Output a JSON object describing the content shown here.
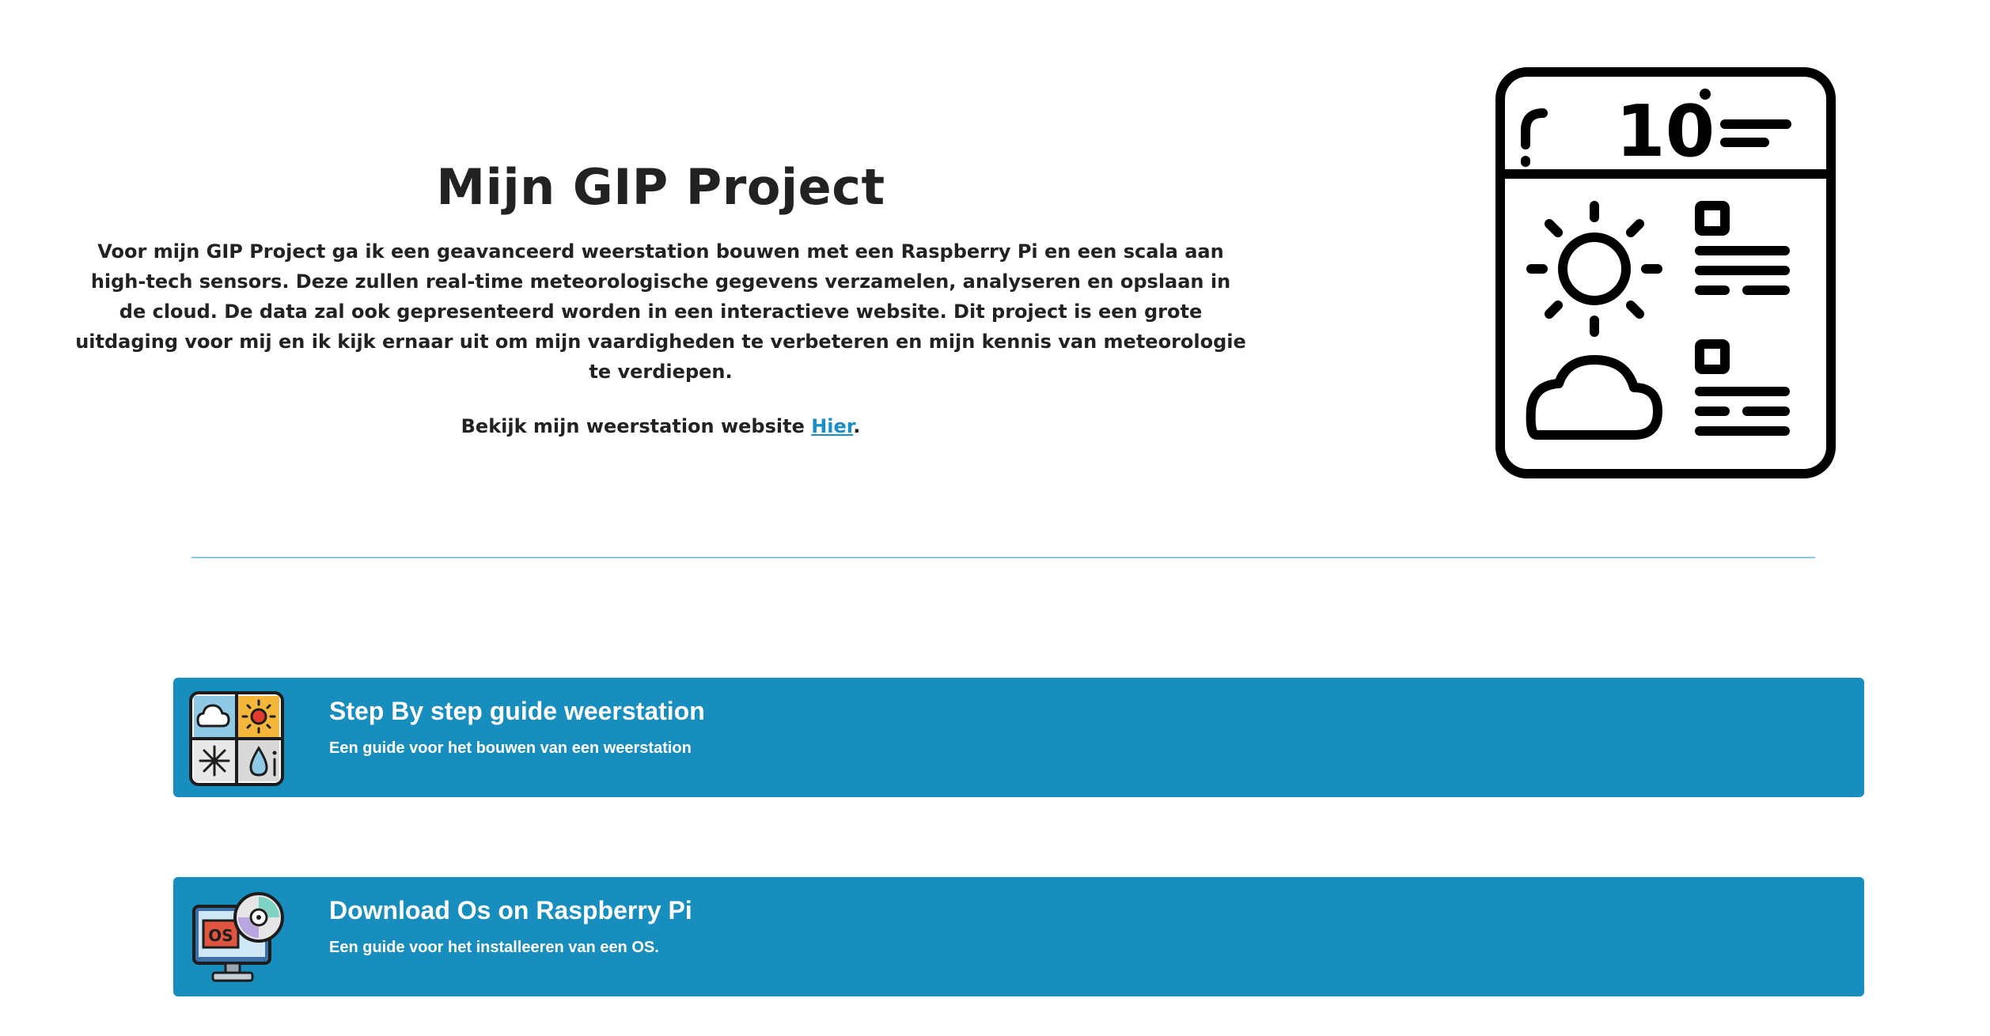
{
  "hero": {
    "title": "Mijn GIP Project",
    "description": "Voor mijn GIP Project ga ik een geavanceerd weerstation bouwen met een Raspberry Pi en een scala aan high-tech sensors. Deze zullen real-time meteorologische gegevens verzamelen, analyseren en opslaan in de cloud. De data zal ook gepresenteerd worden in een interactieve website. Dit project is een grote uitdaging voor mij en ik kijk ernaar uit om mijn vaardigheden te verbeteren en mijn kennis van meteorologie te verdiepen.",
    "link_prefix": "Bekijk mijn weerstation website ",
    "link_text": "Hier",
    "link_suffix": ".",
    "illustration": {
      "icon": "weather-app-icon",
      "temperature": "10"
    }
  },
  "cards": [
    {
      "title": "Step By step guide weerstation",
      "subtitle": "Een guide voor het bouwen van een weerstation",
      "icon": "weather-grid-icon"
    },
    {
      "title": "Download Os on Raspberry Pi",
      "subtitle": "Een guide voor het installeeren van een OS.",
      "icon": "os-monitor-disc-icon",
      "icon_label": "OS"
    }
  ],
  "colors": {
    "card_background": "#188ebe",
    "link": "#1a8ec8",
    "divider": "#8cc7e2",
    "text": "#222222"
  }
}
